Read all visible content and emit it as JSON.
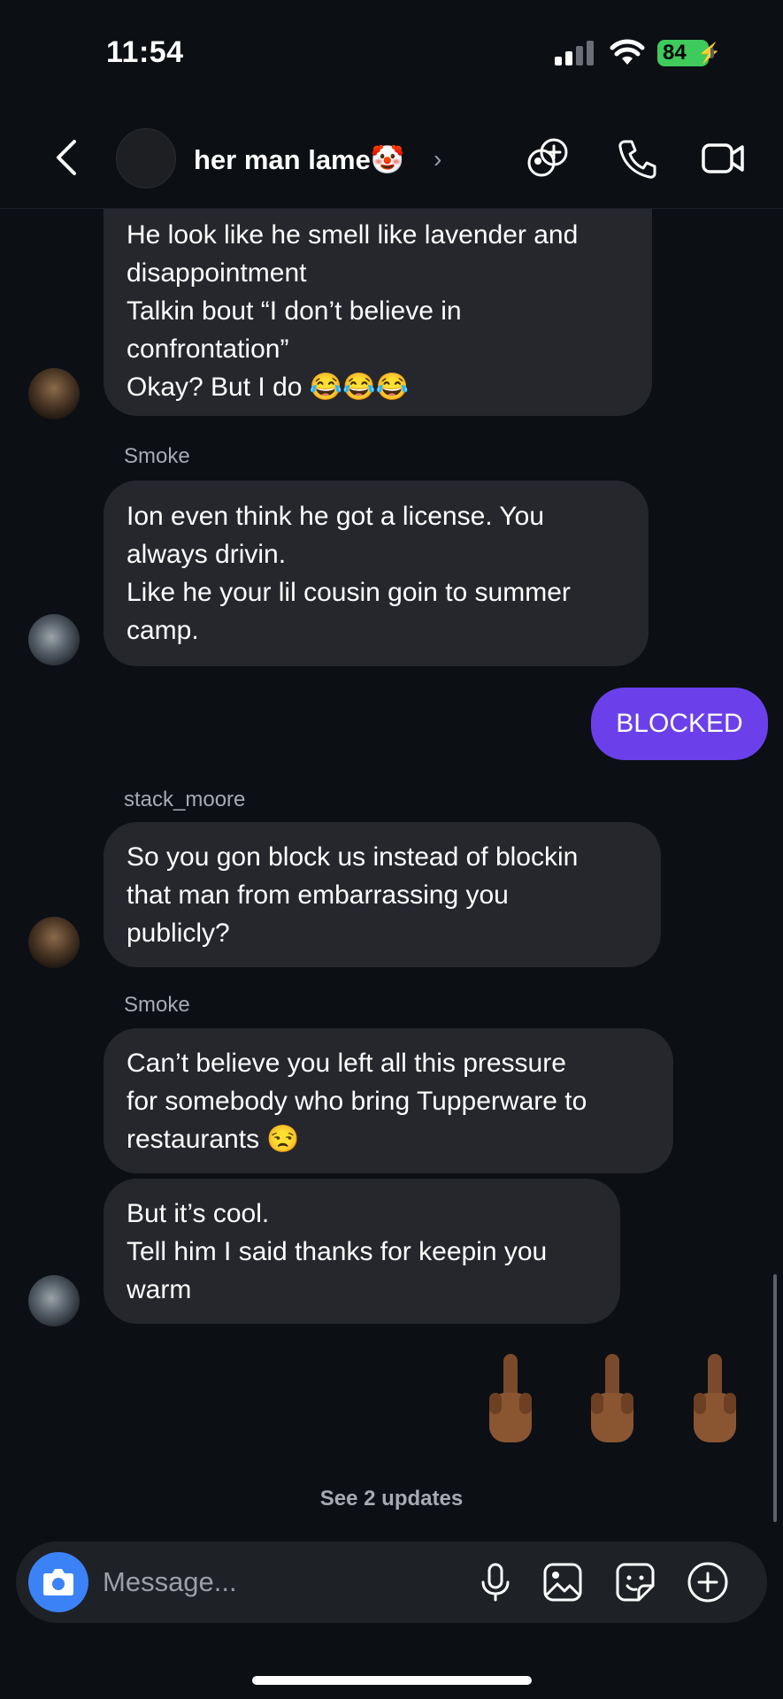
{
  "status": {
    "time": "11:54",
    "battery": "84"
  },
  "header": {
    "title": "her man lame🤡",
    "chevron": "›"
  },
  "messages": {
    "m1": {
      "lines": [
        "He look like he smell like lavender and",
        "disappointment",
        "Talkin bout “I don’t believe in",
        "confrontation”",
        "Okay? But I do 😂😂😂"
      ]
    },
    "m2": {
      "sender": "Smoke",
      "lines": [
        "Ion even think he got a license. You",
        "always drivin.",
        "Like he your lil cousin goin to summer",
        "camp."
      ]
    },
    "m3": {
      "text": "BLOCKED"
    },
    "m4": {
      "sender": "stack_moore",
      "lines": [
        "So you gon block us instead of blockin",
        "that man from embarrassing you",
        "publicly?"
      ]
    },
    "m5": {
      "sender": "Smoke",
      "lines": [
        "Can’t believe you left all this pressure",
        "for somebody who bring Tupperware to",
        "restaurants 😒"
      ]
    },
    "m6": {
      "lines": [
        "But it’s cool.",
        "Tell him I said thanks for keepin you",
        "warm"
      ]
    },
    "m7": {
      "emoji": [
        "🖕🏾",
        "🖕🏾",
        "🖕🏾"
      ]
    }
  },
  "see_updates": "See 2 updates",
  "composer": {
    "placeholder": "Message..."
  },
  "icons": [
    "back-arrow-icon",
    "add-people-icon",
    "phone-icon",
    "video-icon",
    "camera-icon",
    "mic-icon",
    "gallery-icon",
    "sticker-icon",
    "plus-icon"
  ]
}
